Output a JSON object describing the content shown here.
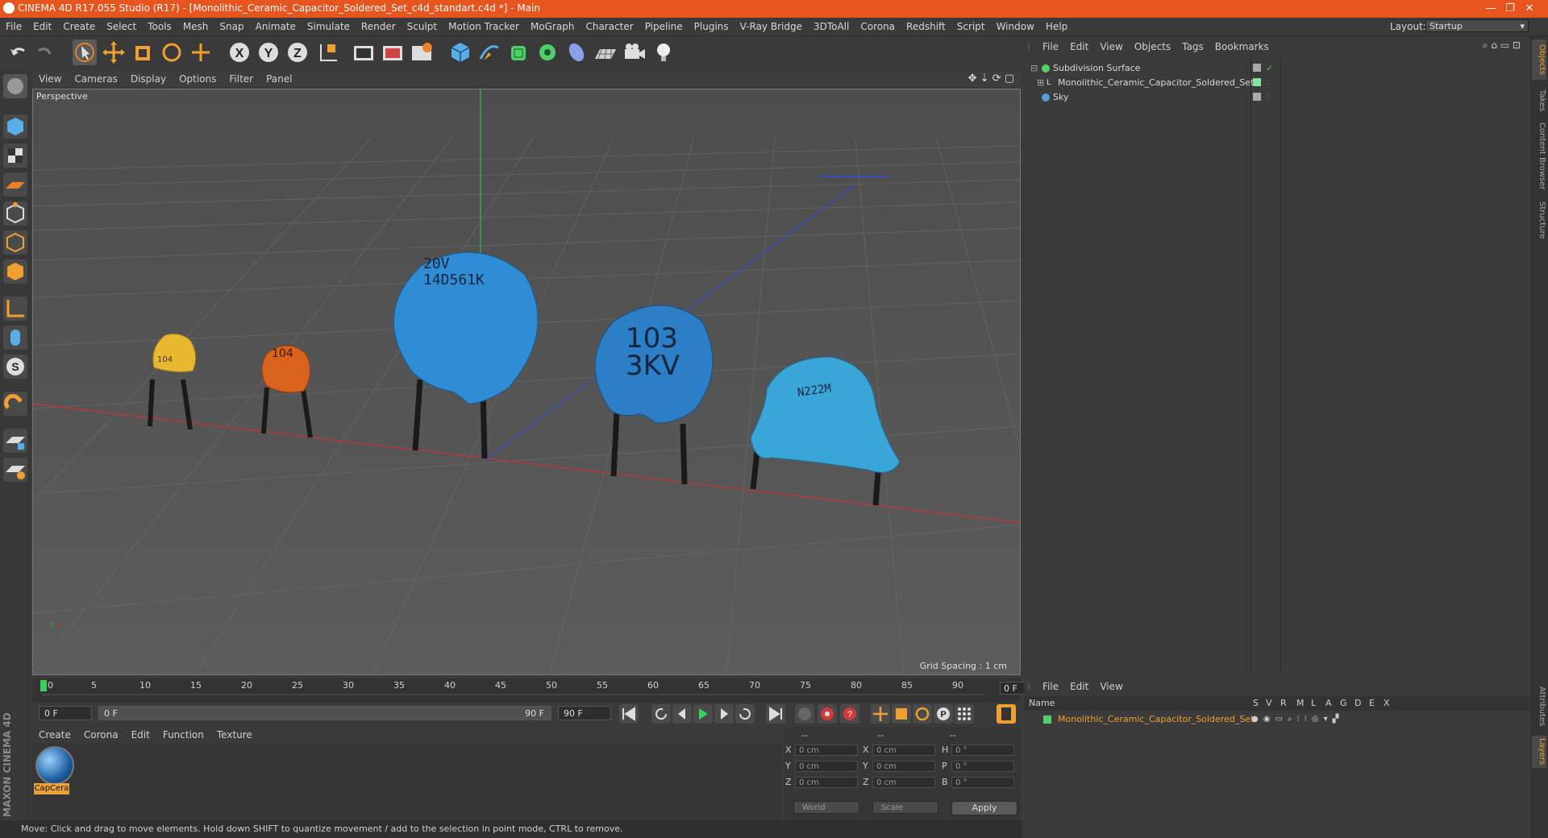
{
  "window": {
    "title": "CINEMA 4D R17.055 Studio (R17) - [Monolithic_Ceramic_Capacitor_Soldered_Set_c4d_standart.c4d *] - Main",
    "minimize": "—",
    "restore": "❐",
    "close": "✕"
  },
  "menu": [
    "File",
    "Edit",
    "Create",
    "Select",
    "Tools",
    "Mesh",
    "Snap",
    "Animate",
    "Simulate",
    "Render",
    "Sculpt",
    "Motion Tracker",
    "MoGraph",
    "Character",
    "Pipeline",
    "Plugins",
    "V-Ray Bridge",
    "3DToAll",
    "Corona",
    "Redshift",
    "Script",
    "Window",
    "Help"
  ],
  "layout": {
    "label": "Layout:",
    "value": "Startup"
  },
  "viewport": {
    "menu": [
      "View",
      "Cameras",
      "Display",
      "Options",
      "Filter",
      "Panel"
    ],
    "label": "Perspective",
    "grid_spacing": "Grid Spacing : 1 cm",
    "capacitors": [
      {
        "color": "#e8b92e",
        "text": "104"
      },
      {
        "color": "#d9621e",
        "text": "104"
      },
      {
        "color": "#2f8dd6",
        "text": "20V 14D561K"
      },
      {
        "color": "#2f8dd6",
        "text": "103 3KV"
      },
      {
        "color": "#3aa6d8",
        "text": "N222M"
      }
    ]
  },
  "timeline": {
    "ticks": [
      "0",
      "5",
      "10",
      "15",
      "20",
      "25",
      "30",
      "35",
      "40",
      "45",
      "50",
      "55",
      "60",
      "65",
      "70",
      "75",
      "80",
      "85",
      "90"
    ],
    "current_frame": "0 F",
    "start": "0 F",
    "range_start": "0 F",
    "range_end": "90 F",
    "end": "90 F"
  },
  "material_panel": {
    "menu": [
      "Create",
      "Corona",
      "Edit",
      "Function",
      "Texture"
    ],
    "material_name": "CapCera"
  },
  "coordinates": {
    "headers": [
      "--",
      "--",
      "--"
    ],
    "rows": [
      {
        "l1": "X",
        "v1": "0 cm",
        "l2": "X",
        "v2": "0 cm",
        "l3": "H",
        "v3": "0 °"
      },
      {
        "l1": "Y",
        "v1": "0 cm",
        "l2": "Y",
        "v2": "0 cm",
        "l3": "P",
        "v3": "0 °"
      },
      {
        "l1": "Z",
        "v1": "0 cm",
        "l2": "Z",
        "v2": "0 cm",
        "l3": "B",
        "v3": "0 °"
      }
    ],
    "mode1": "World",
    "mode2": "Scale",
    "apply": "Apply"
  },
  "status": "Move: Click and drag to move elements. Hold down SHIFT to quantize movement / add to the selection in point mode, CTRL to remove.",
  "object_manager": {
    "menu": [
      "File",
      "Edit",
      "View",
      "Objects",
      "Tags",
      "Bookmarks"
    ],
    "objects": [
      {
        "name": "Subdivision Surface",
        "icon_color": "#4fd06a"
      },
      {
        "name": "Monolithic_Ceramic_Capacitor_Soldered_Set",
        "icon_color": "#d0d0d0"
      },
      {
        "name": "Sky",
        "icon_color": "#5a9ad8"
      }
    ]
  },
  "side_tabs": [
    "Objects",
    "Takes",
    "Content Browser",
    "Structure",
    "Attributes",
    "Layers"
  ],
  "layer_manager": {
    "menu": [
      "File",
      "Edit",
      "View"
    ],
    "columns": [
      "Name",
      "S",
      "V",
      "R",
      "M",
      "L",
      "A",
      "G",
      "D",
      "E",
      "X"
    ],
    "layers": [
      {
        "name": "Monolithic_Ceramic_Capacitor_Soldered_Set",
        "color": "#4fd06a"
      }
    ]
  },
  "brand": "MAXON CINEMA 4D"
}
